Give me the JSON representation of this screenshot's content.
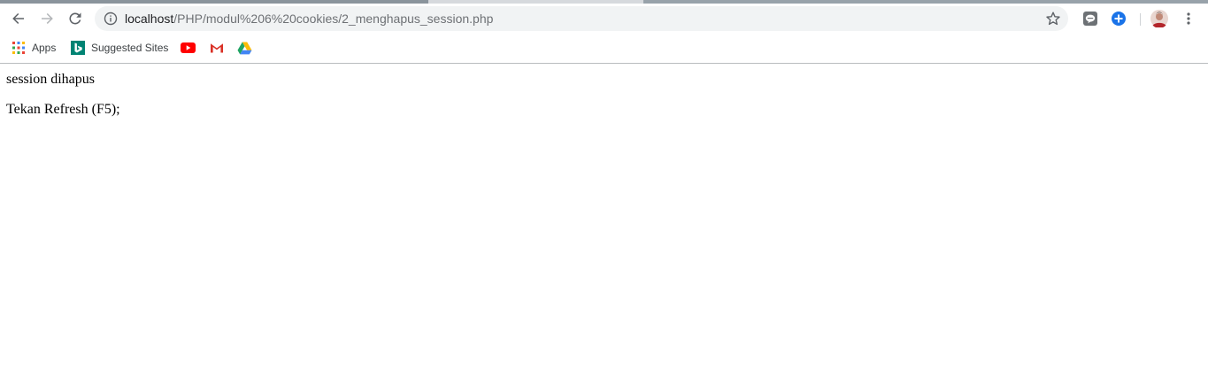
{
  "browser": {
    "url_host": "localhost",
    "url_path": "/PHP/modul%206%20cookies/2_menghapus_session.php",
    "nav": {
      "back_icon": "arrow-left-icon",
      "forward_icon": "arrow-right-icon",
      "reload_icon": "reload-icon"
    },
    "omnibox": {
      "info_icon": "info-icon",
      "bookmark_icon": "star-icon"
    },
    "extensions": [
      "line-extension-icon",
      "add-extension-icon",
      "profile-avatar",
      "menu-kebab-icon"
    ]
  },
  "bookmarks": {
    "apps_label": "Apps",
    "suggested_sites_label": "Suggested Sites",
    "icons": [
      "apps-grid-icon",
      "bing-icon",
      "youtube-icon",
      "gmail-icon",
      "google-drive-icon"
    ]
  },
  "page": {
    "line1": "session dihapus",
    "line2": "Tekan Refresh (F5);"
  },
  "colors": {
    "omnibox_bg": "#f1f3f4",
    "accent_blue": "#1a73e8",
    "youtube_red": "#ff0000",
    "bing_teal": "#008373"
  }
}
